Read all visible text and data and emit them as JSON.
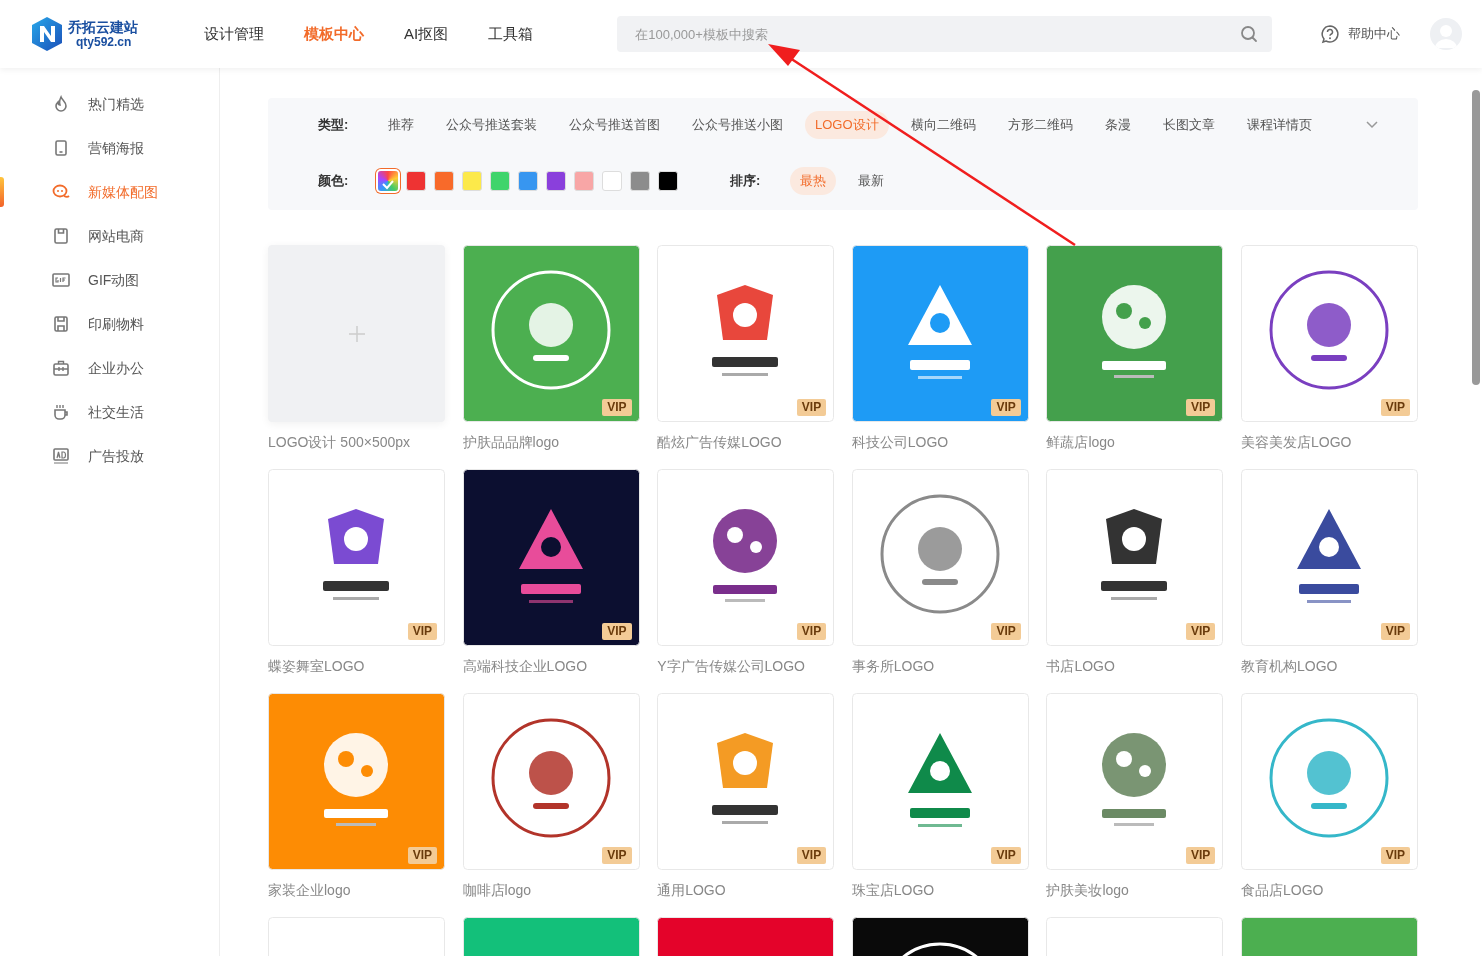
{
  "brand": {
    "name": "乔拓云建站",
    "domain": "qty592.cn"
  },
  "nav": [
    {
      "label": "设计管理",
      "selected": false
    },
    {
      "label": "模板中心",
      "selected": true
    },
    {
      "label": "AI抠图",
      "selected": false
    },
    {
      "label": "工具箱",
      "selected": false
    }
  ],
  "search": {
    "placeholder": "在100,000+模板中搜索"
  },
  "help": {
    "label": "帮助中心"
  },
  "sidebar": {
    "items": [
      {
        "label": "热门精选",
        "selected": false
      },
      {
        "label": "营销海报",
        "selected": false
      },
      {
        "label": "新媒体配图",
        "selected": true
      },
      {
        "label": "网站电商",
        "selected": false
      },
      {
        "label": "GIF动图",
        "selected": false
      },
      {
        "label": "印刷物料",
        "selected": false
      },
      {
        "label": "企业办公",
        "selected": false
      },
      {
        "label": "社交生活",
        "selected": false
      },
      {
        "label": "广告投放",
        "selected": false
      }
    ]
  },
  "filters": {
    "type_label": "类型:",
    "types": [
      {
        "label": "推荐",
        "selected": false
      },
      {
        "label": "公众号推送套装",
        "selected": false
      },
      {
        "label": "公众号推送首图",
        "selected": false
      },
      {
        "label": "公众号推送小图",
        "selected": false
      },
      {
        "label": "LOGO设计",
        "selected": true
      },
      {
        "label": "横向二维码",
        "selected": false
      },
      {
        "label": "方形二维码",
        "selected": false
      },
      {
        "label": "条漫",
        "selected": false
      },
      {
        "label": "长图文章",
        "selected": false
      },
      {
        "label": "课程详情页",
        "selected": false
      }
    ],
    "color_label": "颜色:",
    "colors": [
      {
        "kind": "all",
        "selected": true
      },
      {
        "kind": "swatch",
        "color": "#ee3333",
        "selected": false
      },
      {
        "kind": "swatch",
        "color": "#f86a2a",
        "selected": false
      },
      {
        "kind": "swatch",
        "color": "#fce94a",
        "selected": false
      },
      {
        "kind": "swatch",
        "color": "#3fd46b",
        "selected": false
      },
      {
        "kind": "swatch",
        "color": "#3796f0",
        "selected": false
      },
      {
        "kind": "swatch",
        "color": "#8a3fdc",
        "selected": false
      },
      {
        "kind": "swatch",
        "color": "#f8a6a6",
        "selected": false
      },
      {
        "kind": "swatch",
        "color": "#ffffff",
        "selected": false
      },
      {
        "kind": "swatch",
        "color": "#8c8c8c",
        "selected": false
      },
      {
        "kind": "swatch",
        "color": "#000000",
        "selected": false
      }
    ],
    "sort_label": "排序:",
    "sorts": [
      {
        "label": "最热",
        "selected": true
      },
      {
        "label": "最新",
        "selected": false
      }
    ]
  },
  "cards": [
    {
      "kind": "add",
      "title": "LOGO设计 500×500px"
    },
    {
      "kind": "picture",
      "title": "护肤品品牌logo",
      "badge": "VIP"
    },
    {
      "kind": "picture",
      "title": "酷炫广告传媒LOGO",
      "badge": "VIP"
    },
    {
      "kind": "picture",
      "title": "科技公司LOGO",
      "badge": "VIP"
    },
    {
      "kind": "picture",
      "title": "鲜蔬店logo",
      "badge": "VIP"
    },
    {
      "kind": "picture",
      "title": "美容美发店LOGO",
      "badge": "VIP"
    },
    {
      "kind": "picture",
      "title": "蝶姿舞室LOGO",
      "badge": "VIP"
    },
    {
      "kind": "picture",
      "title": "高端科技企业LOGO",
      "badge": "VIP"
    },
    {
      "kind": "picture",
      "title": "Y字广告传媒公司LOGO",
      "badge": "VIP"
    },
    {
      "kind": "picture",
      "title": "事务所LOGO",
      "badge": "VIP"
    },
    {
      "kind": "picture",
      "title": "书店LOGO",
      "badge": "VIP"
    },
    {
      "kind": "picture",
      "title": "教育机构LOGO",
      "badge": "VIP"
    },
    {
      "kind": "picture",
      "title": "家装企业logo",
      "badge": "VIP"
    },
    {
      "kind": "picture",
      "title": "咖啡店logo",
      "badge": "VIP"
    },
    {
      "kind": "picture",
      "title": "通用LOGO",
      "badge": "VIP"
    },
    {
      "kind": "picture",
      "title": "珠宝店LOGO",
      "badge": "VIP"
    },
    {
      "kind": "picture",
      "title": "护肤美妆logo",
      "badge": "VIP"
    },
    {
      "kind": "picture",
      "title": "食品店LOGO",
      "badge": "VIP"
    },
    {
      "kind": "picture"
    },
    {
      "kind": "picture"
    },
    {
      "kind": "picture"
    },
    {
      "kind": "picture"
    },
    {
      "kind": "picture"
    },
    {
      "kind": "picture"
    }
  ]
}
